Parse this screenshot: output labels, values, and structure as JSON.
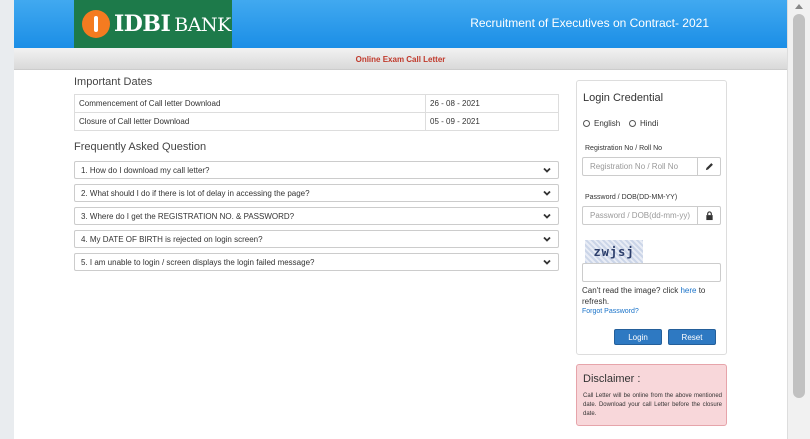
{
  "header": {
    "logo_text": "IDBI",
    "logo_bank": "BANK",
    "title": "Recruitment of Executives on Contract- 2021"
  },
  "subbar": {
    "title": "Online Exam Call Letter"
  },
  "important_dates": {
    "title": "Important Dates",
    "rows": [
      {
        "label": "Commencement of Call letter Download",
        "date": "26 - 08 - 2021"
      },
      {
        "label": "Closure of Call letter Download",
        "date": "05 - 09 - 2021"
      }
    ]
  },
  "faq": {
    "title": "Frequently Asked Question",
    "items": [
      "1. How do I download my call letter?",
      "2. What should I do if there is lot of delay in accessing the page?",
      "3. Where do I get the REGISTRATION NO. & PASSWORD?",
      "4. My DATE OF BIRTH is rejected on login screen?",
      "5. I am unable to login / screen displays the login failed message?"
    ]
  },
  "login": {
    "title": "Login Credential",
    "lang_english": "English",
    "lang_hindi": "Hindi",
    "reg_label": "Registration No / Roll No",
    "reg_placeholder": "Registration No / Roll No",
    "pwd_label": "Password / DOB(DD-MM-YY)",
    "pwd_placeholder": "Password / DOB(dd-mm-yy)",
    "captcha_text": "zwjsj",
    "cant_read_prefix": "Can't read the image? click ",
    "cant_read_link": "here",
    "cant_read_suffix": " to refresh.",
    "forgot": "Forgot Password?",
    "login_button": "Login",
    "reset_button": "Reset"
  },
  "disclaimer": {
    "title": "Disclaimer :",
    "text": "Call Letter will be online from the above mentioned date. Download your call Letter before the closure date."
  },
  "icons": {
    "reg_icon": "pencil-icon",
    "pwd_icon": "lock-icon",
    "faq_icon": "chevron-down-icon"
  },
  "colors": {
    "header_blue": "#1b8ee6",
    "logo_green": "#1d7a4a",
    "logo_orange": "#f47b20",
    "subtitle_red": "#c0392b",
    "button_blue": "#2e79c2",
    "disclaimer_bg": "#f8d7da"
  }
}
